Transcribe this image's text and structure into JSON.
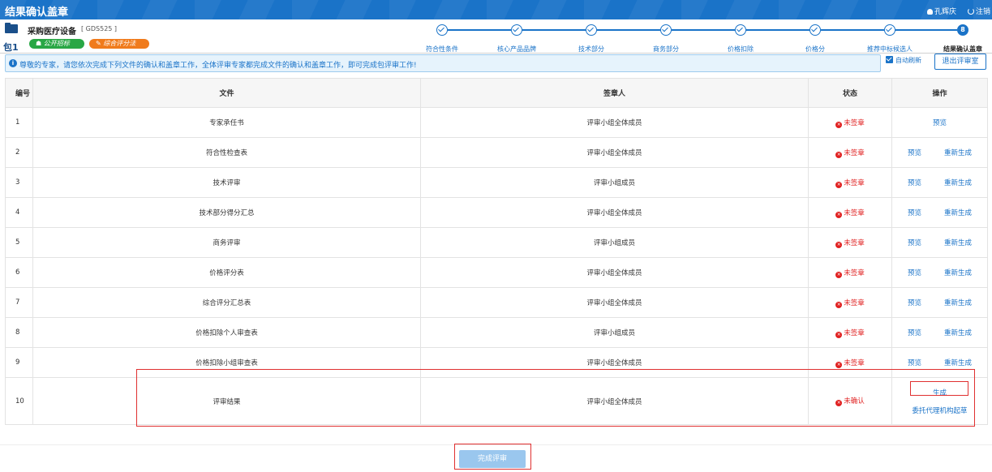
{
  "app": {
    "title": "结果确认盖章",
    "user": "孔辉庆",
    "logout": "注销"
  },
  "project": {
    "name": "采购医疗设备",
    "code": "[ GDS525 ]",
    "package": "包1",
    "badges": [
      "公开招标",
      "综合评分法"
    ]
  },
  "steps": [
    {
      "label": "符合性条件",
      "done": true
    },
    {
      "label": "核心产品品牌",
      "done": true
    },
    {
      "label": "技术部分",
      "done": true
    },
    {
      "label": "商务部分",
      "done": true
    },
    {
      "label": "价格扣除",
      "done": true
    },
    {
      "label": "价格分",
      "done": true
    },
    {
      "label": "推荐中标候选人",
      "done": true
    },
    {
      "label": "结果确认盖章",
      "done": false,
      "num": "8"
    }
  ],
  "notice": "尊敬的专家，请您依次完成下列文件的确认和盖章工作，全体评审专家都完成文件的确认和盖章工作，即可完成包评审工作!",
  "controls": {
    "auto_refresh": "自动刷新",
    "exit": "退出评审室",
    "finish": "完成评审"
  },
  "table": {
    "headers": [
      "编号",
      "文件",
      "签章人",
      "状态",
      "操作"
    ],
    "rows": [
      {
        "no": "1",
        "file": "专家承任书",
        "signer": "评审小组全体成员",
        "status": "未签章",
        "ops": [
          "预览"
        ]
      },
      {
        "no": "2",
        "file": "符合性检查表",
        "signer": "评审小组全体成员",
        "status": "未签章",
        "ops": [
          "预览",
          "重新生成"
        ]
      },
      {
        "no": "3",
        "file": "技术评审",
        "signer": "评审小组成员",
        "status": "未签章",
        "ops": [
          "预览",
          "重新生成"
        ]
      },
      {
        "no": "4",
        "file": "技术部分得分汇总",
        "signer": "评审小组全体成员",
        "status": "未签章",
        "ops": [
          "预览",
          "重新生成"
        ]
      },
      {
        "no": "5",
        "file": "商务评审",
        "signer": "评审小组成员",
        "status": "未签章",
        "ops": [
          "预览",
          "重新生成"
        ]
      },
      {
        "no": "6",
        "file": "价格评分表",
        "signer": "评审小组全体成员",
        "status": "未签章",
        "ops": [
          "预览",
          "重新生成"
        ]
      },
      {
        "no": "7",
        "file": "综合评分汇总表",
        "signer": "评审小组全体成员",
        "status": "未签章",
        "ops": [
          "预览",
          "重新生成"
        ]
      },
      {
        "no": "8",
        "file": "价格扣除个人审查表",
        "signer": "评审小组成员",
        "status": "未签章",
        "ops": [
          "预览",
          "重新生成"
        ]
      },
      {
        "no": "9",
        "file": "价格扣除小组审查表",
        "signer": "评审小组全体成员",
        "status": "未签章",
        "ops": [
          "预览",
          "重新生成"
        ]
      },
      {
        "no": "10",
        "file": "评审结果",
        "signer": "评审小组全体成员",
        "status": "未确认",
        "ops": [
          "生成",
          "委托代理机构起草"
        ]
      }
    ]
  }
}
